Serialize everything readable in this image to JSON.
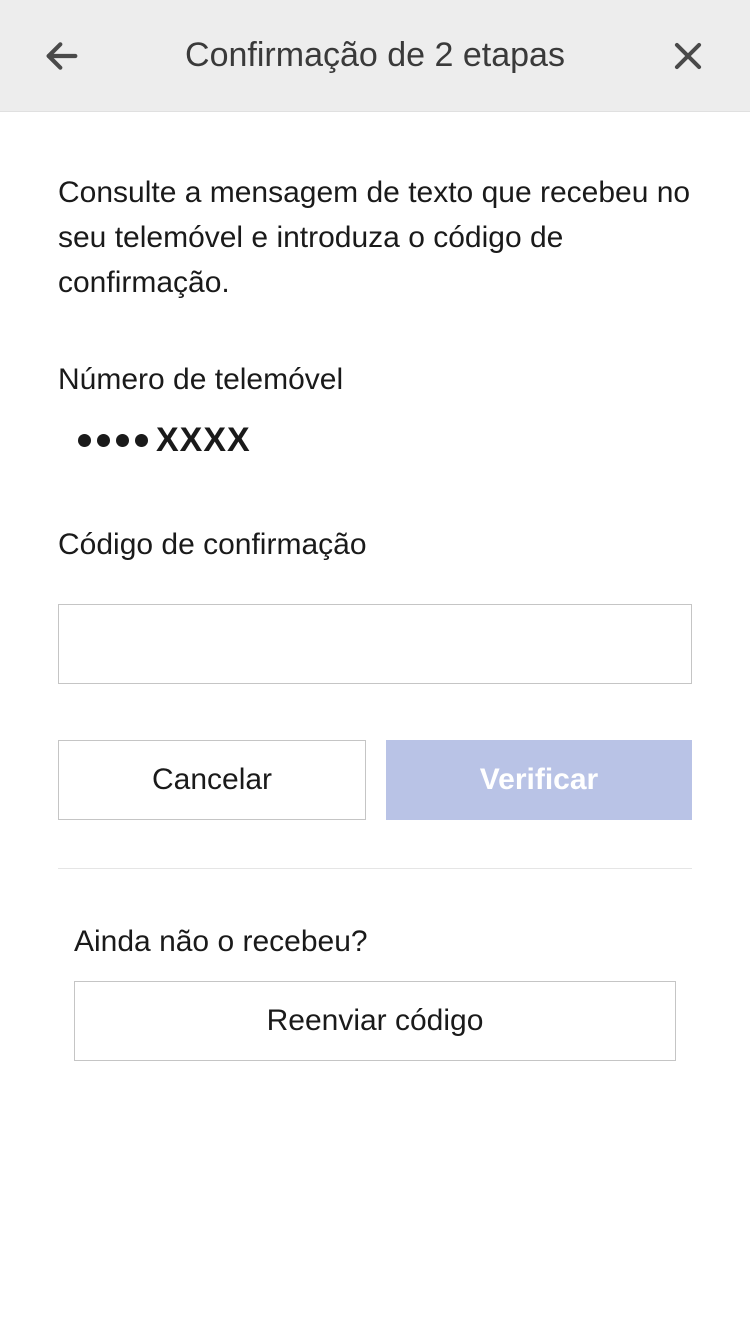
{
  "header": {
    "title": "Confirmação de 2 etapas"
  },
  "main": {
    "instruction": "Consulte a mensagem de texto que recebeu no seu telemóvel e introduza o código de confirmação.",
    "phone_label": "Número de telemóvel",
    "phone_masked_suffix": "XXXX",
    "code_label": "Código de confirmação",
    "code_value": "",
    "cancel_label": "Cancelar",
    "verify_label": "Verificar",
    "resend_prompt": "Ainda não o recebeu?",
    "resend_label": "Reenviar código"
  }
}
